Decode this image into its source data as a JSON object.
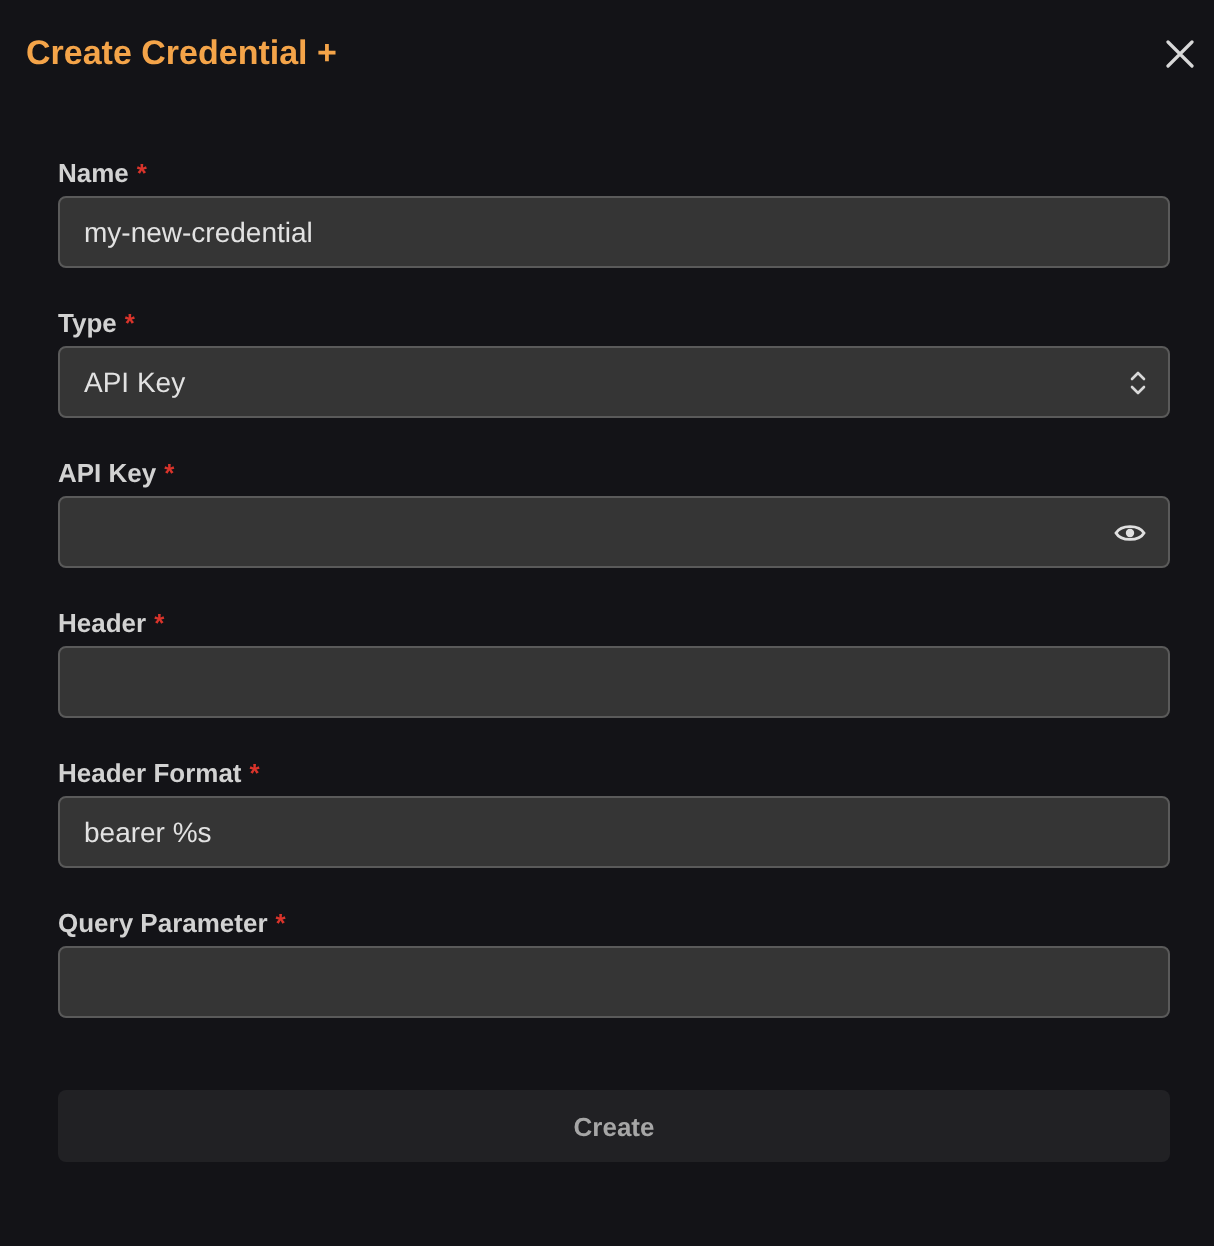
{
  "dialog": {
    "title": "Create Credential +"
  },
  "fields": [
    {
      "kind": "text",
      "label": "Name",
      "required_mark": "*",
      "value": "my-new-credential"
    },
    {
      "kind": "select",
      "label": "Type",
      "required_mark": "*",
      "value": "API Key"
    },
    {
      "kind": "secret",
      "label": "API Key",
      "required_mark": "*"
    },
    {
      "kind": "text",
      "label": "Header",
      "required_mark": "*"
    },
    {
      "kind": "text",
      "label": "Header Format",
      "required_mark": "*",
      "value": "bearer %s"
    },
    {
      "kind": "text",
      "label": "Query Parameter",
      "required_mark": "*"
    }
  ],
  "submit": {
    "label": "Create"
  }
}
